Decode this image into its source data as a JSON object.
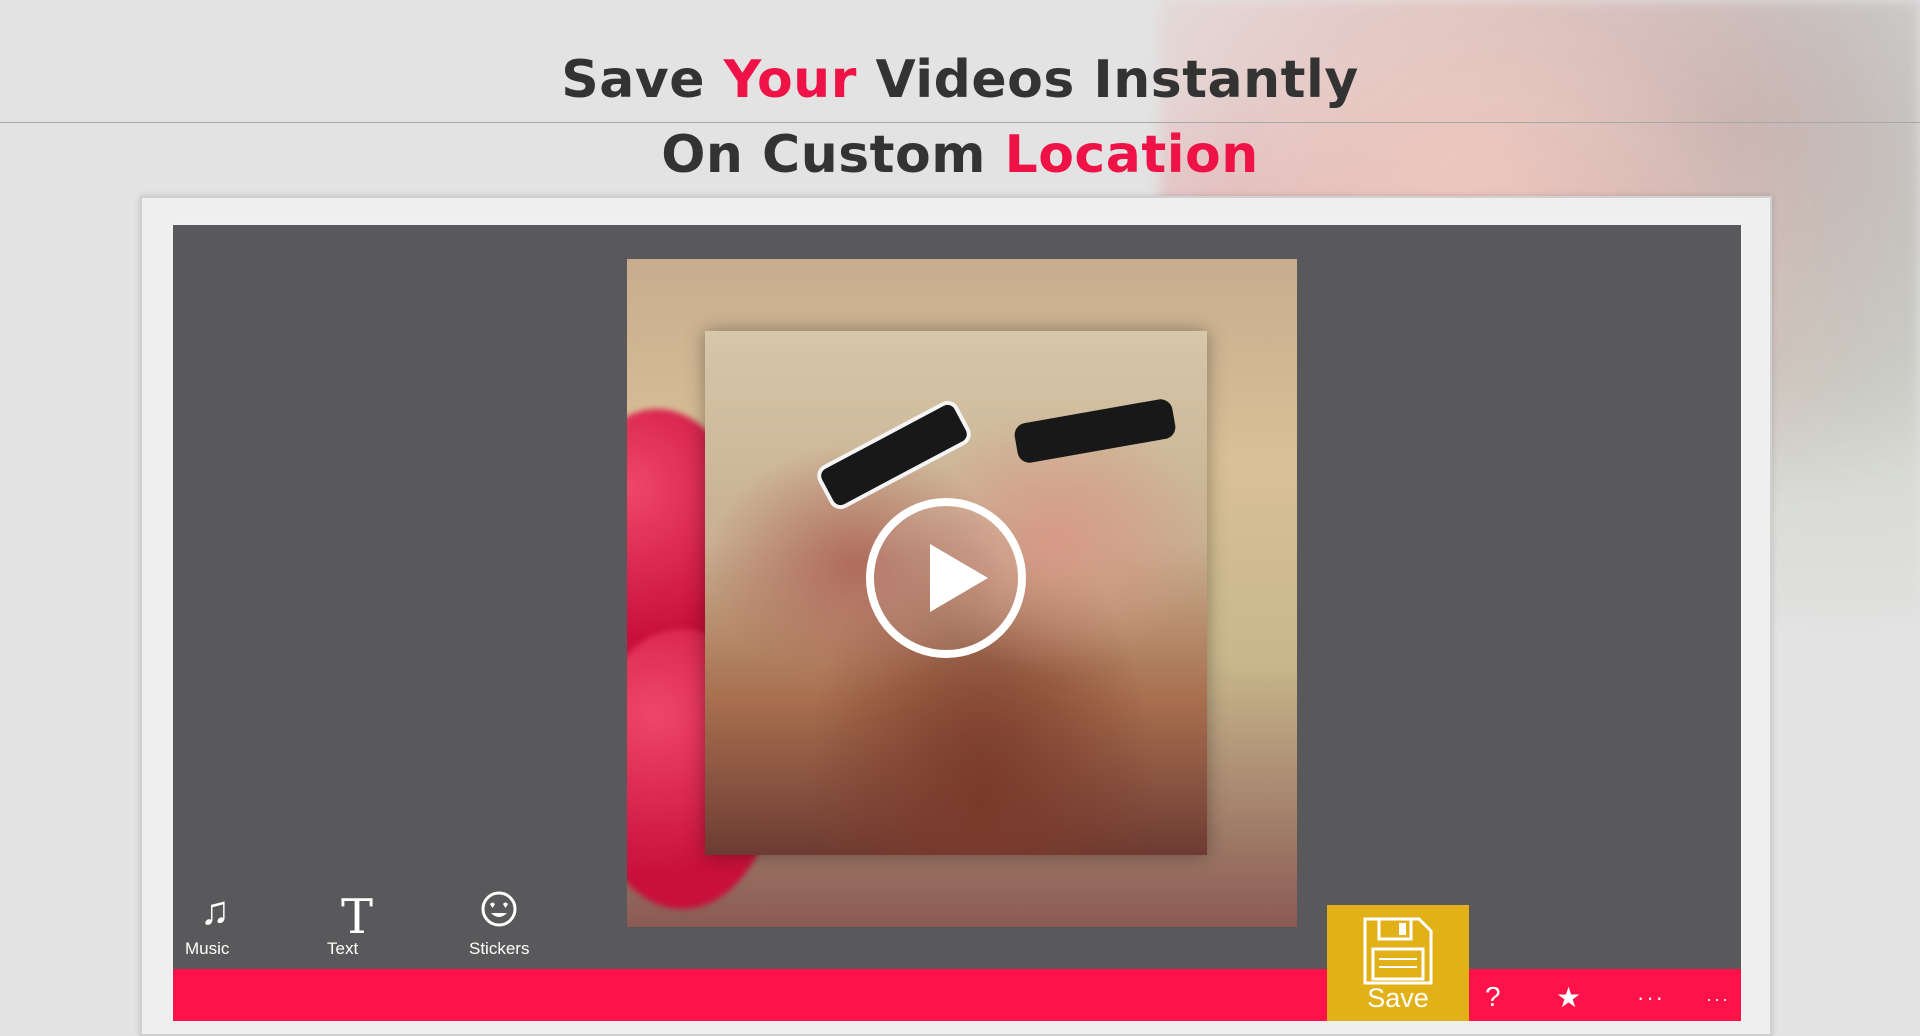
{
  "headline": {
    "line1_pre": "Save ",
    "line1_accent": "Your",
    "line1_post": " Videos Instantly",
    "line2_pre": "On Custom ",
    "line2_accent": "Location"
  },
  "tools": {
    "music": {
      "label": "Music",
      "icon": "music-note-icon"
    },
    "text": {
      "label": "Text",
      "icon": "text-icon",
      "glyph": "T"
    },
    "stickers": {
      "label": "Stickers",
      "icon": "smiley-heart-eyes-icon"
    }
  },
  "save": {
    "label": "Save",
    "icon": "floppy-disk-icon"
  },
  "bottom_bar": {
    "help": "?",
    "star": "★",
    "more1": "···",
    "more2": "···"
  },
  "colors": {
    "accent": "#ee1247",
    "bar": "#ff1249",
    "save_button": "#e2b118",
    "canvas": "#59595b"
  }
}
